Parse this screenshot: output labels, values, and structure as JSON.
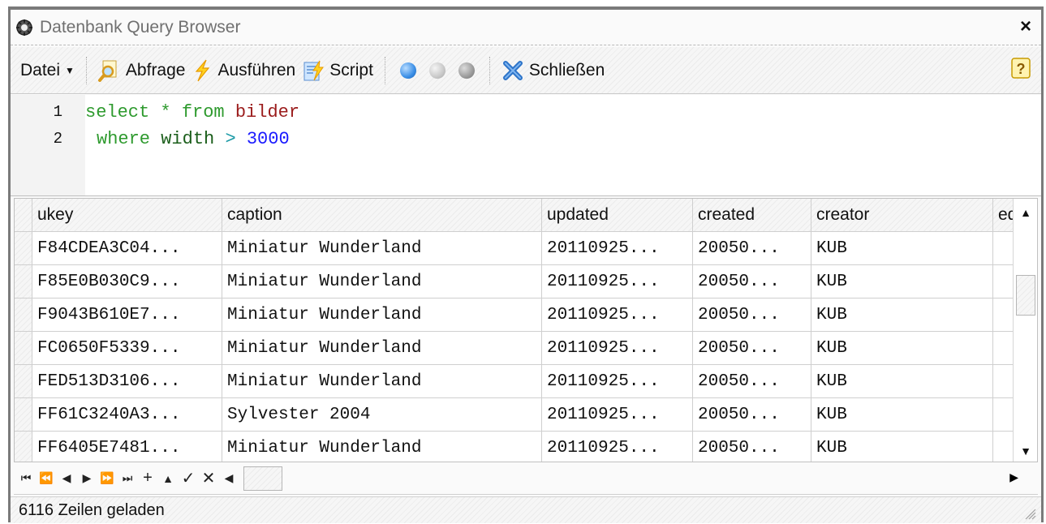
{
  "window": {
    "title": "Datenbank Query Browser",
    "close_label": "×"
  },
  "toolbar": {
    "datei_label": "Datei",
    "abfrage_label": "Abfrage",
    "ausfuehren_label": "Ausführen",
    "script_label": "Script",
    "schliessen_label": "Schließen",
    "status_colors": [
      "#3a8ee6",
      "#c8c8c8",
      "#9a9a9a"
    ]
  },
  "editor": {
    "lines": [
      {
        "number": "1",
        "tokens": [
          "select",
          "*",
          "from",
          "bilder"
        ]
      },
      {
        "number": "2",
        "tokens": [
          "where",
          "width",
          ">",
          "3000"
        ]
      }
    ]
  },
  "grid": {
    "columns": [
      "ukey",
      "caption",
      "updated",
      "created",
      "creator",
      "ed"
    ],
    "rows": [
      [
        "F84CDEA3C04...",
        "Miniatur Wunderland",
        "20110925...",
        "20050...",
        "KUB",
        ""
      ],
      [
        "F85E0B030C9...",
        "Miniatur Wunderland",
        "20110925...",
        "20050...",
        "KUB",
        ""
      ],
      [
        "F9043B610E7...",
        "Miniatur Wunderland",
        "20110925...",
        "20050...",
        "KUB",
        ""
      ],
      [
        "FC0650F5339...",
        "Miniatur Wunderland",
        "20110925...",
        "20050...",
        "KUB",
        ""
      ],
      [
        "FED513D3106...",
        "Miniatur Wunderland",
        "20110925...",
        "20050...",
        "KUB",
        ""
      ],
      [
        "FF61C3240A3...",
        "Sylvester 2004",
        "20110925...",
        "20050...",
        "KUB",
        ""
      ],
      [
        "FF6405E7481...",
        "Miniatur Wunderland",
        "20110925...",
        "20050...",
        "KUB",
        ""
      ]
    ]
  },
  "navigator": {
    "buttons": [
      "⏮",
      "⏪",
      "◀",
      "▶",
      "⏩",
      "⏭",
      "+",
      "▲",
      "✓",
      "✕"
    ]
  },
  "status": {
    "text": "6116 Zeilen geladen"
  }
}
